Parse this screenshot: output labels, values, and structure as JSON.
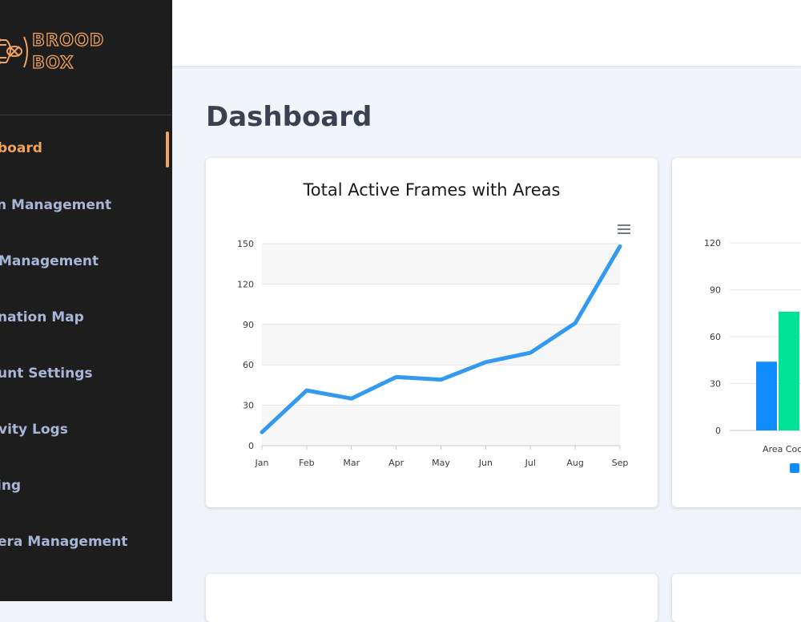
{
  "app": {
    "logo_line1": "BROOD",
    "logo_line2": "BOX",
    "logo_icon": "bee-circuit-icon",
    "accent_color": "#f0a25e"
  },
  "sidebar": {
    "items": [
      {
        "label": "board",
        "active": true
      },
      {
        "label": "n Management"
      },
      {
        "label": "Management"
      },
      {
        "label": "nation Map"
      },
      {
        "label": "unt Settings"
      },
      {
        "label": "vity Logs"
      },
      {
        "label": "ing"
      },
      {
        "label": "era Management"
      }
    ]
  },
  "page": {
    "title": "Dashboard"
  },
  "cards": {
    "line_chart": {
      "menu_icon": "hamburger-menu-icon"
    },
    "bar_chart": {
      "legend_icon": "legend-swatch"
    }
  },
  "chart_data": [
    {
      "type": "line",
      "title": "Total Active Frames with Areas",
      "xlabel": "",
      "ylabel": "",
      "categories": [
        "Jan",
        "Feb",
        "Mar",
        "Apr",
        "May",
        "Jun",
        "Jul",
        "Aug",
        "Sep"
      ],
      "series": [
        {
          "values": [
            10,
            41,
            35,
            51,
            49,
            62,
            69,
            91,
            148
          ],
          "color": "#339af0"
        }
      ],
      "ylim": [
        0,
        150
      ],
      "yticks": [
        0,
        30,
        60,
        90,
        120,
        150
      ],
      "grid": true
    },
    {
      "type": "bar",
      "title": "",
      "categories": [
        "Area Coc"
      ],
      "series": [
        {
          "values": [
            44
          ],
          "color": "#0f8cff"
        },
        {
          "values": [
            76
          ],
          "color": "#00e396"
        }
      ],
      "ylim": [
        0,
        120
      ],
      "yticks": [
        0,
        30,
        60,
        90,
        120
      ],
      "grid": true
    }
  ]
}
